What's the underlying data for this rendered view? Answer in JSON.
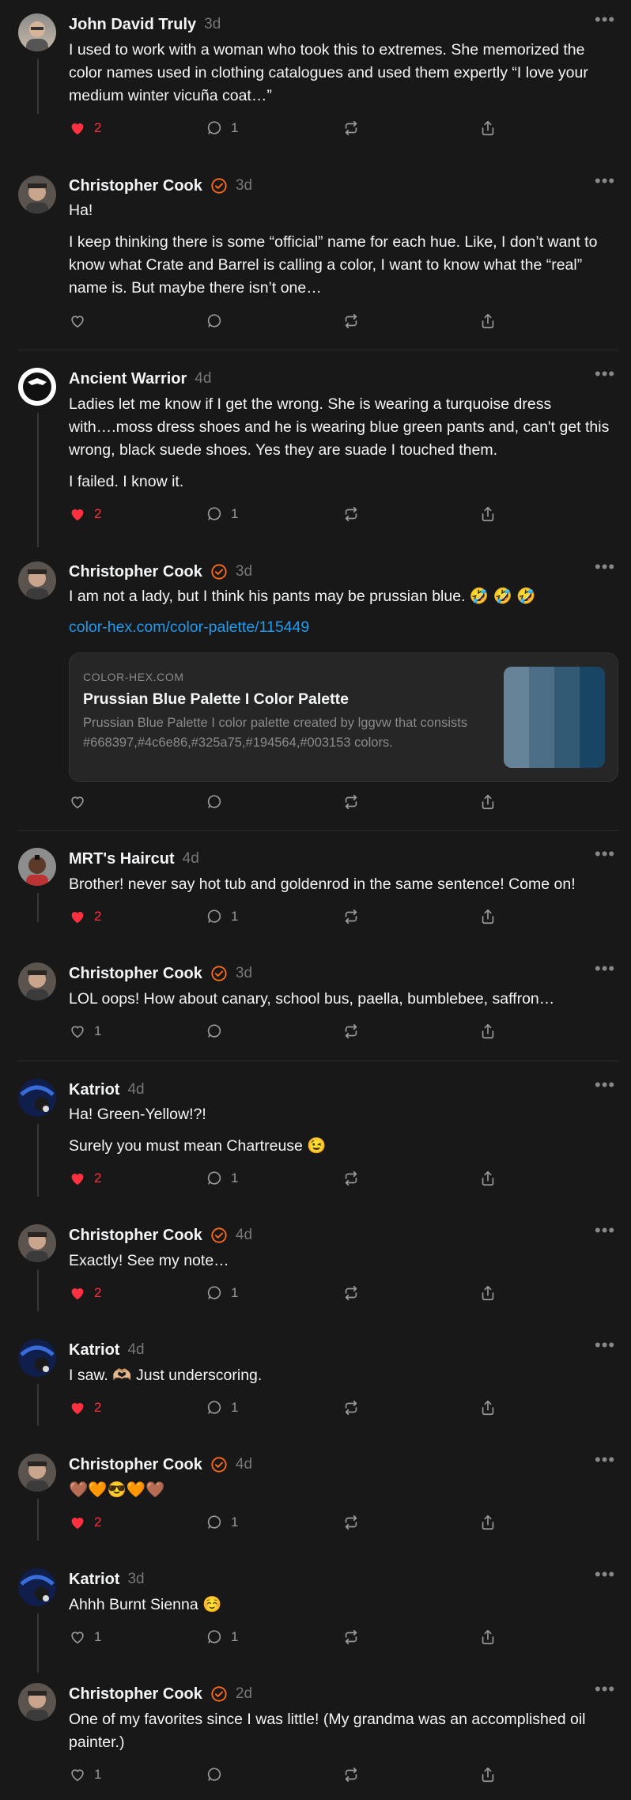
{
  "colors": {
    "like": "#ff3040",
    "verified": "#ff6b1a",
    "link": "#1f9bf0"
  },
  "posts": [
    {
      "author": "John David Truly",
      "time": "3d",
      "verified": false,
      "paragraphs": [
        "I used to work with a woman who took this to extremes. She memorized the color names used in clothing catalogues and used them expertly “I love your medium winter vicuña coat…”"
      ],
      "likes": "2",
      "liked": true,
      "replies": "1"
    },
    {
      "author": "Christopher Cook",
      "time": "3d",
      "verified": true,
      "paragraphs": [
        "Ha!",
        "I keep thinking there is some “official” name for each hue. Like, I don’t want to know what Crate and Barrel is calling a color, I want to know what the “real” name is. But maybe there isn’t one…"
      ],
      "likes": "",
      "liked": false,
      "replies": ""
    },
    {
      "author": "Ancient Warrior",
      "time": "4d",
      "verified": false,
      "paragraphs": [
        "Ladies let me know if I get the wrong. She is wearing a turquoise dress with….moss dress shoes and he is wearing blue green pants and, can't get this wrong, black suede shoes. Yes they are suade I touched them.",
        "I failed. I know it."
      ],
      "likes": "2",
      "liked": true,
      "replies": "1"
    },
    {
      "author": "Christopher Cook",
      "time": "3d",
      "verified": true,
      "paragraphs": [
        "I am not a lady, but I think his pants may be prussian blue. 🤣 🤣 🤣"
      ],
      "link": "color-hex.com/color-palette/115449",
      "card": {
        "domain": "COLOR-HEX.COM",
        "title": "Prussian Blue Palette I Color Palette",
        "description": "Prussian Blue Palette I color palette created by lggvw that consists #668397,#4c6e86,#325a75,#194564,#003153 colors.",
        "swatches": [
          "#668397",
          "#4c6e86",
          "#325a75",
          "#194564"
        ]
      },
      "likes": "",
      "liked": false,
      "replies": ""
    },
    {
      "author": "MRT's Haircut",
      "time": "4d",
      "verified": false,
      "paragraphs": [
        "Brother! never say hot tub and goldenrod in the same sentence! Come on!"
      ],
      "likes": "2",
      "liked": true,
      "replies": "1"
    },
    {
      "author": "Christopher Cook",
      "time": "3d",
      "verified": true,
      "paragraphs": [
        "LOL oops! How about canary, school bus, paella, bumblebee, saffron…"
      ],
      "likes": "1",
      "liked": false,
      "replies": ""
    },
    {
      "author": "Katriot",
      "time": "4d",
      "verified": false,
      "paragraphs": [
        "Ha! Green-Yellow!?!",
        "Surely you must mean Chartreuse 😉"
      ],
      "likes": "2",
      "liked": true,
      "replies": "1"
    },
    {
      "author": "Christopher Cook",
      "time": "4d",
      "verified": true,
      "paragraphs": [
        "Exactly! See my note…"
      ],
      "likes": "2",
      "liked": true,
      "replies": "1"
    },
    {
      "author": "Katriot",
      "time": "4d",
      "verified": false,
      "paragraphs": [
        "I saw. 🫶🏼 Just underscoring."
      ],
      "likes": "2",
      "liked": true,
      "replies": "1"
    },
    {
      "author": "Christopher Cook",
      "time": "4d",
      "verified": true,
      "paragraphs": [
        "🤎🧡😎🧡🤎"
      ],
      "likes": "2",
      "liked": true,
      "replies": "1"
    },
    {
      "author": "Katriot",
      "time": "3d",
      "verified": false,
      "paragraphs": [
        "Ahhh Burnt Sienna ☺️"
      ],
      "likes": "1",
      "liked": false,
      "replies": "1"
    },
    {
      "author": "Christopher Cook",
      "time": "2d",
      "verified": true,
      "paragraphs": [
        "One of my favorites since I was little! (My grandma was an accomplished oil painter.)"
      ],
      "likes": "1",
      "liked": false,
      "replies": ""
    }
  ]
}
